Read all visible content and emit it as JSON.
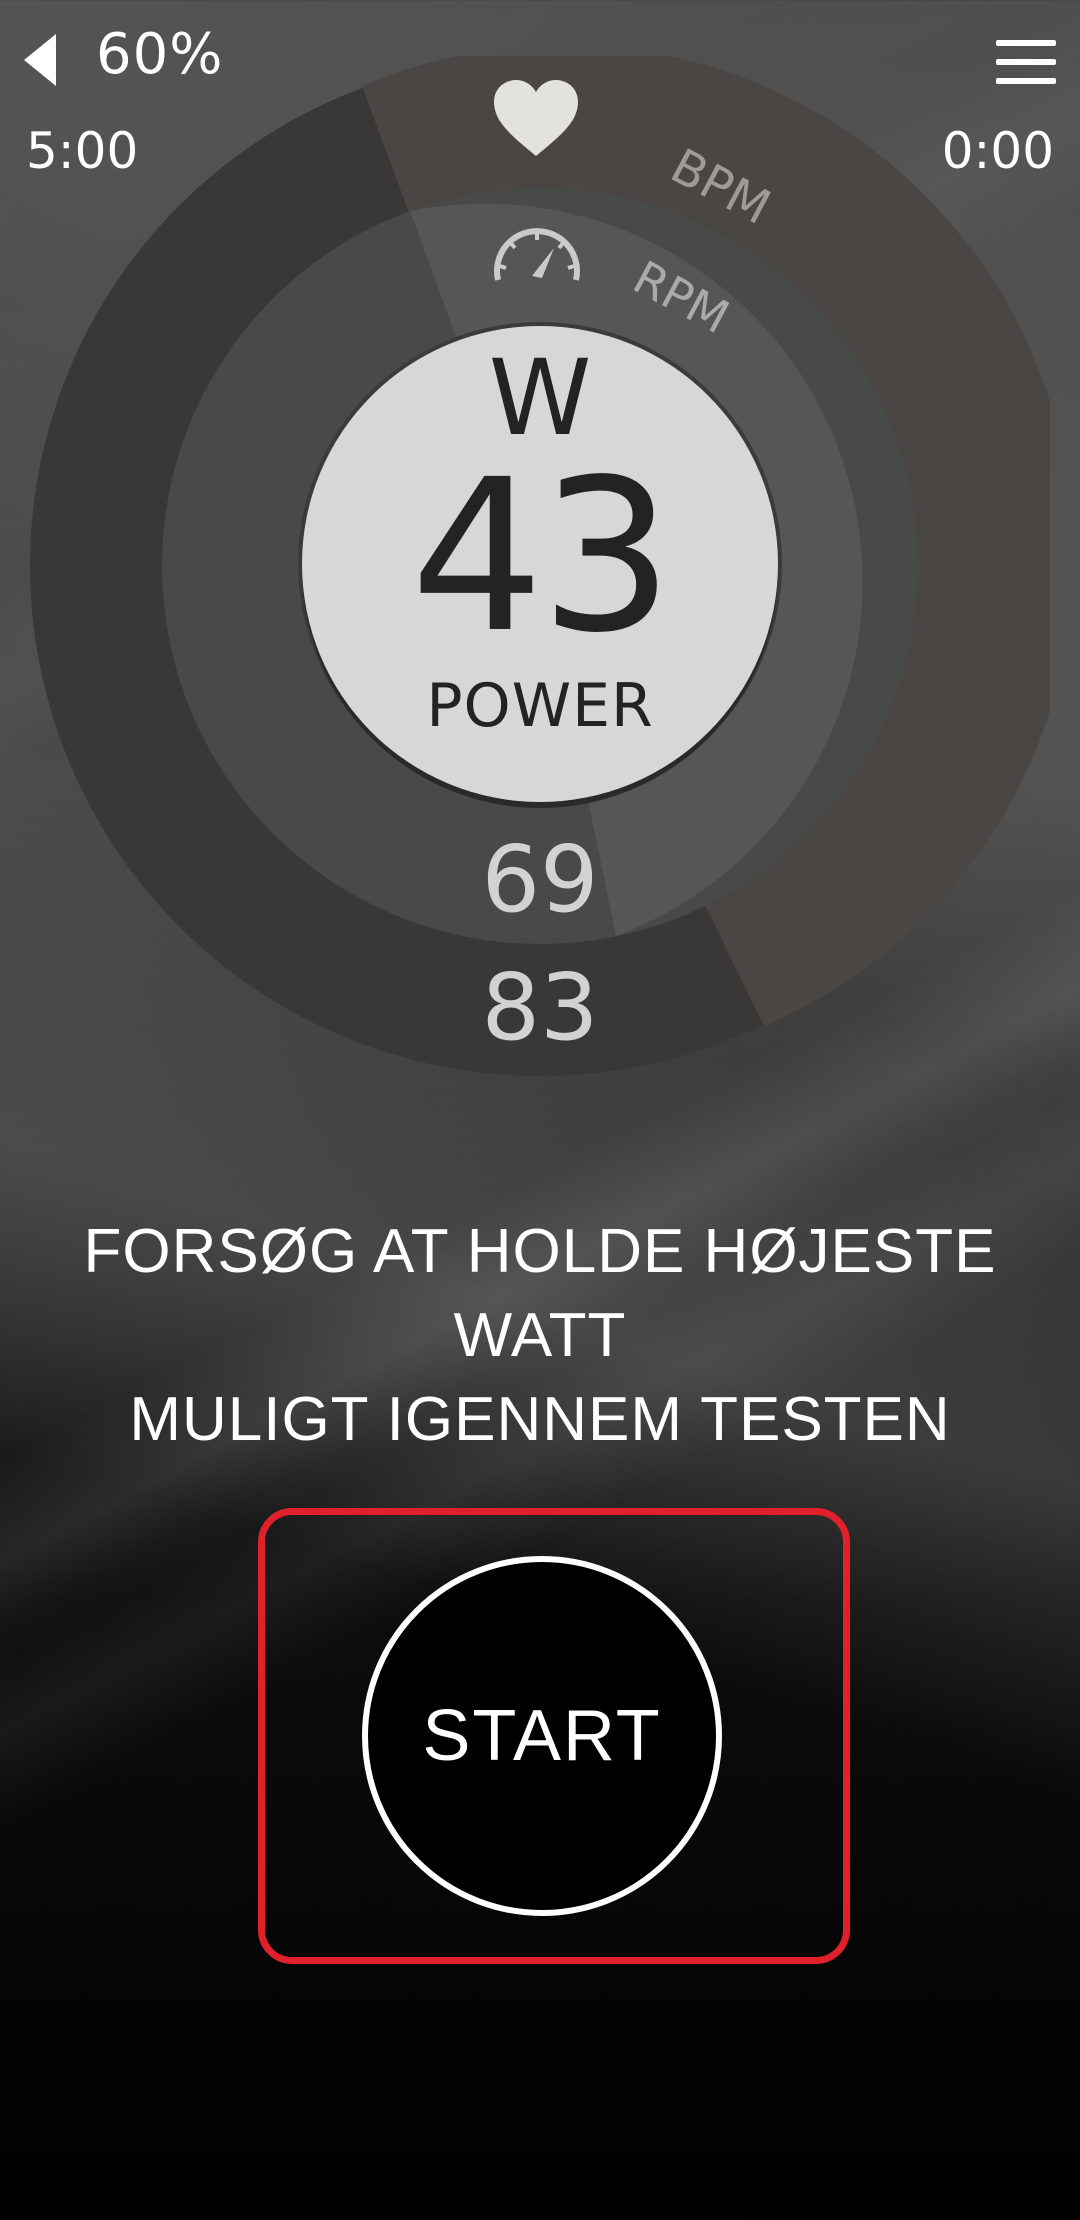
{
  "topbar": {
    "back_icon": "chevron-left-icon",
    "battery": "60%",
    "menu_icon": "hamburger-menu-icon",
    "elapsed_left": "5:00",
    "elapsed_right": "0:00"
  },
  "gauge": {
    "heart_icon": "heart-icon",
    "speed_icon": "speedometer-icon",
    "bpm_label": "BPM",
    "rpm_label": "RPM",
    "unit": "W",
    "power_value": "43",
    "power_label": "POWER",
    "rpm_value": "69",
    "bpm_value": "83",
    "colors": {
      "outer_ring": "#3a3837",
      "outer_arc": "#4a4644",
      "inner_ring": "#474a48",
      "inner_arc": "#545754",
      "center_disc": "#d6d7d9"
    }
  },
  "instruction": {
    "line1": "FORSØG AT HOLDE HØJESTE",
    "line2": "WATT",
    "line3": "MULIGT IGENNEM TESTEN"
  },
  "start": {
    "label": "START",
    "highlight_color": "#e0202a"
  }
}
